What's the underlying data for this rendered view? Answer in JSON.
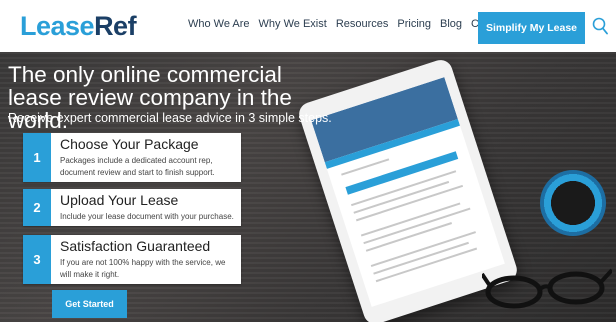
{
  "header": {
    "logo": {
      "part1": "Lease",
      "part2": "Ref"
    },
    "nav": [
      "Who We Are",
      "Why We Exist",
      "Resources",
      "Pricing",
      "Blog",
      "Contact"
    ],
    "cta": "Simplify My Lease"
  },
  "hero": {
    "title": "The only online commercial lease review company in the world.",
    "subtitle": "Receive expert commercial lease advice in 3 simple steps.",
    "steps": [
      {
        "number": "1",
        "title": "Choose Your Package",
        "desc": "Packages include a dedicated account rep, document review and start to finish support."
      },
      {
        "number": "2",
        "title": "Upload Your Lease",
        "desc": "Include your lease document with your purchase."
      },
      {
        "number": "3",
        "title": "Satisfaction Guaranteed",
        "desc": "If you are not 100% happy with the service, we will make it right."
      }
    ],
    "button": "Get Started"
  },
  "colors": {
    "accent": "#2a9fd8",
    "brand_dark": "#1b3f66"
  }
}
